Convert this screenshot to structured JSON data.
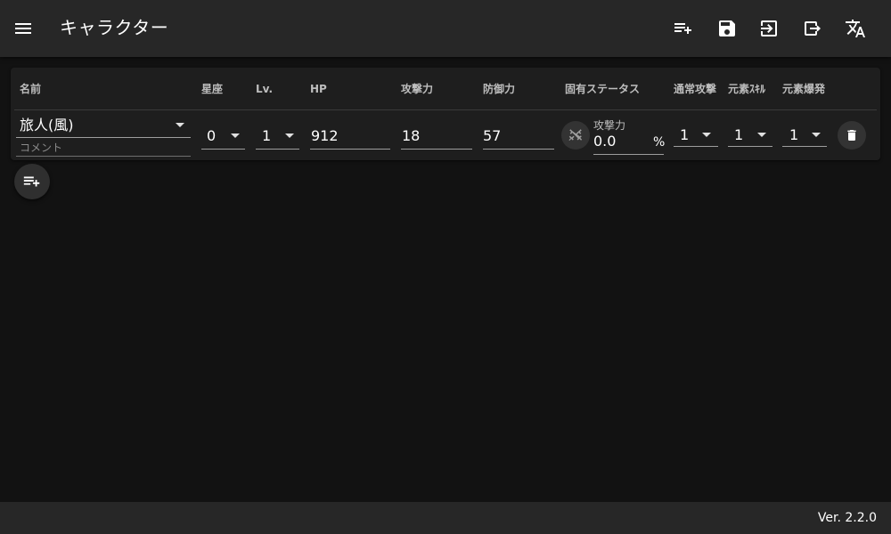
{
  "app": {
    "title": "キャラクター",
    "version": "Ver. 2.2.0"
  },
  "toolbar": {
    "icons": [
      "menu-icon",
      "playlist-add-icon",
      "save-icon",
      "import-icon",
      "export-icon",
      "translate-icon"
    ]
  },
  "table": {
    "headers": {
      "name": "名前",
      "constellation": "星座",
      "level": "Lv.",
      "hp": "HP",
      "atk": "攻撃力",
      "def": "防御力",
      "special_stat": "固有ステータス",
      "normal_attack": "通常攻撃",
      "elemental_skill": "元素ｽｷﾙ",
      "elemental_burst": "元素爆発"
    },
    "row": {
      "name": "旅人(風)",
      "comment_placeholder": "コメント",
      "constellation": "0",
      "level": "1",
      "hp": "912",
      "atk": "18",
      "def": "57",
      "special_stat_label": "攻撃力",
      "special_stat_value": "0.0",
      "special_stat_unit": "%",
      "normal_attack": "1",
      "elemental_skill": "1",
      "elemental_burst": "1"
    }
  },
  "colors": {
    "background": "#121212",
    "appbar": "#272727",
    "card": "#1e1e1e"
  }
}
